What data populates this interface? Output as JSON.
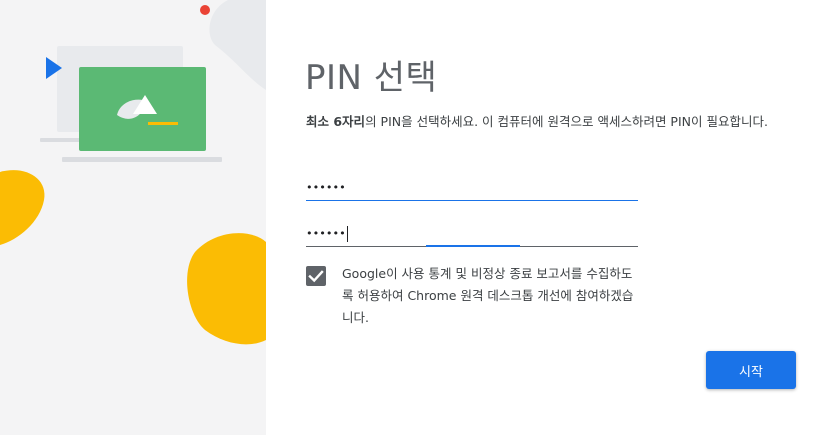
{
  "page": {
    "title": "PIN 선택",
    "description_bold": "최소 6자리",
    "description_rest": "의 PIN을 선택하세요. 이 컴퓨터에 원격으로 액세스하려면 PIN이 필요합니다.",
    "pin_value": "••••••",
    "pin_confirm_value": "••••••",
    "consent_checked": true,
    "consent_text": "Google이 사용 통계 및 비정상 종료 보고서를 수집하도록 허용하여 Chrome 원격 데스크톱 개선에 참여하겠습니다.",
    "start_label": "시작"
  },
  "colors": {
    "accent": "#1a73e8",
    "illustration_green": "#5bb974",
    "illustration_yellow": "#fbbc04",
    "illustration_blue": "#1a73e8",
    "illustration_red": "#ea4335"
  },
  "icons": {
    "illustration": "computer-illustration",
    "checkbox": "check-icon"
  }
}
